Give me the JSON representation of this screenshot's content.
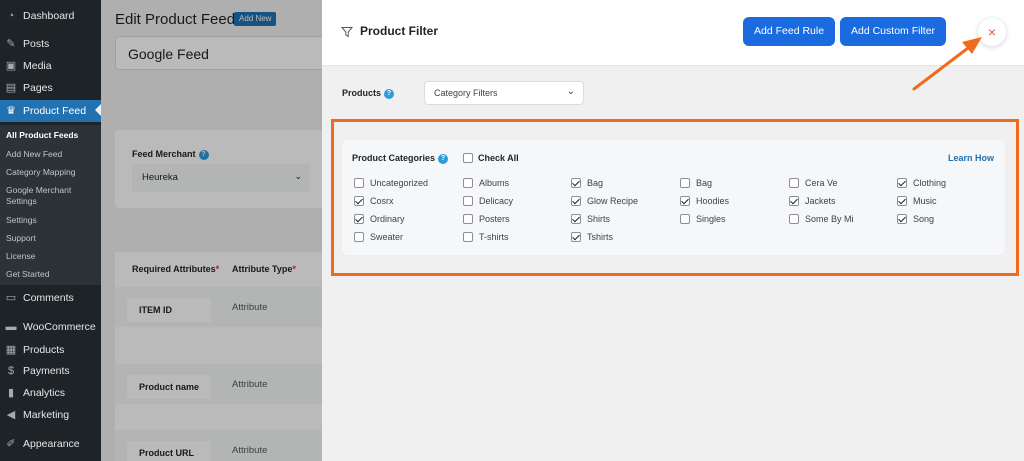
{
  "sidebar": {
    "items": [
      {
        "label": "Dashboard",
        "icon": "dashboard-icon"
      },
      {
        "label": "Posts",
        "icon": "pin-icon"
      },
      {
        "label": "Media",
        "icon": "media-icon"
      },
      {
        "label": "Pages",
        "icon": "pages-icon"
      },
      {
        "label": "Product Feed",
        "icon": "product-feed-icon"
      },
      {
        "label": "Comments",
        "icon": "comments-icon"
      },
      {
        "label": "WooCommerce",
        "icon": "woocommerce-icon"
      },
      {
        "label": "Products",
        "icon": "products-icon"
      },
      {
        "label": "Payments",
        "icon": "payments-icon"
      },
      {
        "label": "Analytics",
        "icon": "analytics-icon"
      },
      {
        "label": "Marketing",
        "icon": "marketing-icon"
      },
      {
        "label": "Appearance",
        "icon": "appearance-icon"
      }
    ],
    "submenu": [
      "All Product Feeds",
      "Add New Feed",
      "Category Mapping",
      "Google Merchant Settings",
      "Settings",
      "Support",
      "License",
      "Get Started"
    ]
  },
  "page": {
    "title": "Edit Product Feed",
    "add_new": "Add New",
    "feed_name": "Google Feed",
    "merchant_label": "Feed Merchant",
    "merchant_value": "Heureka",
    "required_attributes": "Required Attributes",
    "attribute_type": "Attribute Type",
    "rows": [
      {
        "name": "ITEM ID",
        "type": "Attribute"
      },
      {
        "name": "Product name",
        "type": "Attribute"
      },
      {
        "name": "Product URL",
        "type": "Attribute"
      }
    ]
  },
  "drawer": {
    "title": "Product Filter",
    "add_feed_rule": "Add Feed Rule",
    "add_custom_filter": "Add Custom Filter",
    "close": "×",
    "products_label": "Products",
    "category_select": "Category Filters",
    "categories_title": "Product Categories",
    "check_all": "Check All",
    "learn_how": "Learn How",
    "categories": [
      {
        "label": "Uncategorized",
        "checked": false
      },
      {
        "label": "Albums",
        "checked": false
      },
      {
        "label": "Bag",
        "checked": true
      },
      {
        "label": "Bag",
        "checked": false
      },
      {
        "label": "Cera Ve",
        "checked": false
      },
      {
        "label": "Clothing",
        "checked": true
      },
      {
        "label": "Cosrx",
        "checked": true
      },
      {
        "label": "Delicacy",
        "checked": false
      },
      {
        "label": "Glow Recipe",
        "checked": true
      },
      {
        "label": "Hoodies",
        "checked": true
      },
      {
        "label": "Jackets",
        "checked": true
      },
      {
        "label": "Music",
        "checked": true
      },
      {
        "label": "Ordinary",
        "checked": true
      },
      {
        "label": "Posters",
        "checked": false
      },
      {
        "label": "Shirts",
        "checked": true
      },
      {
        "label": "Singles",
        "checked": false
      },
      {
        "label": "Some By Mi",
        "checked": false
      },
      {
        "label": "Song",
        "checked": true
      },
      {
        "label": "Sweater",
        "checked": false
      },
      {
        "label": "T-shirts",
        "checked": false
      },
      {
        "label": "Tshirts",
        "checked": true
      }
    ]
  },
  "colors": {
    "accent_blue": "#1a6be0",
    "highlight_orange": "#f26b1d",
    "wp_sidebar": "#1d2327",
    "wp_active": "#2271b1"
  }
}
